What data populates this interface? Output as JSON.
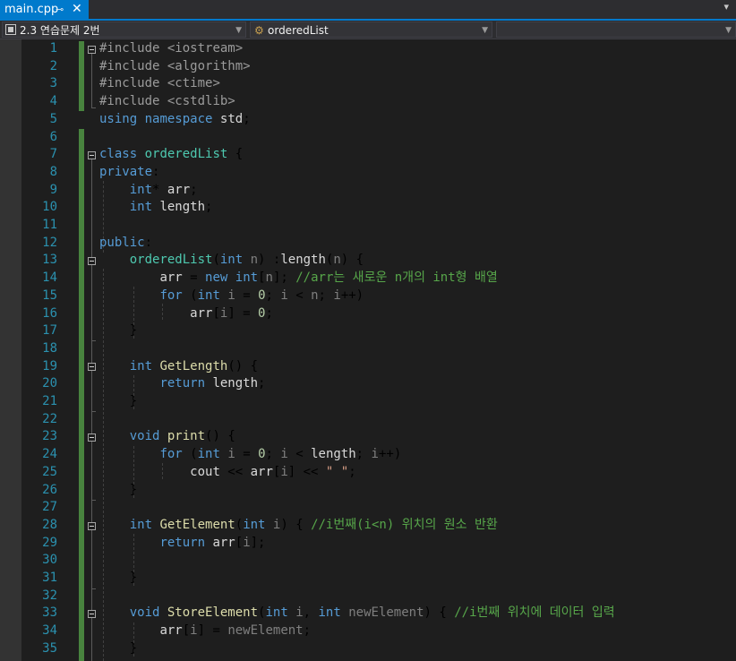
{
  "tab": {
    "filename": "main.cpp",
    "pin_glyph": "⊸",
    "close_glyph": "✕"
  },
  "navbar": {
    "project": "2.3 연습문제 2번",
    "scope": "orderedList",
    "member": ""
  },
  "colors": {
    "accent": "#007acc",
    "change_bar": "#57a64a",
    "line_number": "#2b91af"
  },
  "lines": [
    {
      "n": "1",
      "t": "#include <iostream>"
    },
    {
      "n": "2",
      "t": "#include <algorithm>"
    },
    {
      "n": "3",
      "t": "#include <ctime>"
    },
    {
      "n": "4",
      "t": "#include <cstdlib>"
    },
    {
      "n": "5",
      "t": "using namespace std;"
    },
    {
      "n": "6",
      "t": ""
    },
    {
      "n": "7",
      "t": "class orderedList {"
    },
    {
      "n": "8",
      "t": "private:"
    },
    {
      "n": "9",
      "t": "    int* arr;"
    },
    {
      "n": "10",
      "t": "    int length;"
    },
    {
      "n": "11",
      "t": ""
    },
    {
      "n": "12",
      "t": "public:"
    },
    {
      "n": "13",
      "t": "    orderedList(int n) :length(n) {"
    },
    {
      "n": "14",
      "t": "        arr = new int[n]; //arr는 새로운 n개의 int형 배열"
    },
    {
      "n": "15",
      "t": "        for (int i = 0; i < n; i++)"
    },
    {
      "n": "16",
      "t": "            arr[i] = 0;"
    },
    {
      "n": "17",
      "t": "    }"
    },
    {
      "n": "18",
      "t": ""
    },
    {
      "n": "19",
      "t": "    int GetLength() {"
    },
    {
      "n": "20",
      "t": "        return length;"
    },
    {
      "n": "21",
      "t": "    }"
    },
    {
      "n": "22",
      "t": ""
    },
    {
      "n": "23",
      "t": "    void print() {"
    },
    {
      "n": "24",
      "t": "        for (int i = 0; i < length; i++)"
    },
    {
      "n": "25",
      "t": "            cout << arr[i] << \" \";"
    },
    {
      "n": "26",
      "t": "    }"
    },
    {
      "n": "27",
      "t": ""
    },
    {
      "n": "28",
      "t": "    int GetElement(int i) { //i번째(i<n) 위치의 원소 반환"
    },
    {
      "n": "29",
      "t": "        return arr[i];"
    },
    {
      "n": "30",
      "t": ""
    },
    {
      "n": "31",
      "t": "    }"
    },
    {
      "n": "32",
      "t": ""
    },
    {
      "n": "33",
      "t": "    void StoreElement(int i, int newElement) { //i번째 위치에 데이터 입력"
    },
    {
      "n": "34",
      "t": "        arr[i] = newElement;"
    },
    {
      "n": "35",
      "t": "    }"
    }
  ]
}
